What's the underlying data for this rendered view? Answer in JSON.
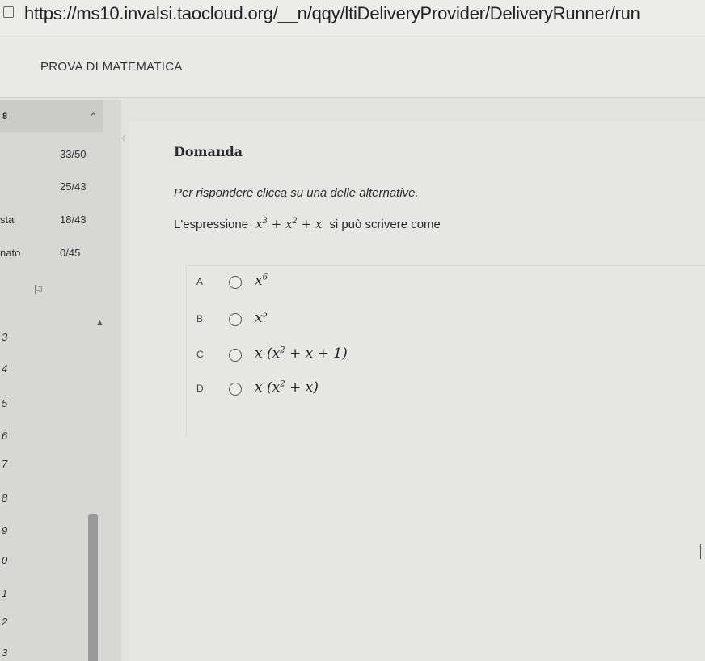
{
  "browser": {
    "url": "https://ms10.invalsi.taocloud.org/__n/qqy/ltiDeliveryProvider/DeliveryRunner/run"
  },
  "app": {
    "title": "PROVA DI MATEMATICA"
  },
  "sidebar": {
    "header_label": "8",
    "sections": [
      {
        "label": "",
        "count": "33/50"
      },
      {
        "label": "",
        "count": "25/43"
      },
      {
        "label": "sta",
        "count": "18/43"
      },
      {
        "label": "nato",
        "count": "0/45"
      }
    ],
    "question_numbers": [
      "3",
      "4",
      "5",
      "6",
      "7",
      "8",
      "9",
      "0",
      "1",
      "2",
      "3"
    ]
  },
  "question": {
    "heading": "Domanda",
    "instruction": "Per rispondere clicca su una delle alternative.",
    "text_before": "L'espressione",
    "text_after": "si può scrivere come",
    "options": [
      {
        "letter": "A"
      },
      {
        "letter": "B"
      },
      {
        "letter": "C"
      },
      {
        "letter": "D"
      }
    ]
  },
  "icons": [
    "page-icon",
    "chevron-up-icon",
    "flag-icon",
    "collapse-up-icon",
    "chevron-left-icon",
    "radio-icon"
  ],
  "colors": {
    "sidebar": "#d7d7d6",
    "content": "#e6e6e5",
    "scrollbar": "#9a9a9b"
  }
}
